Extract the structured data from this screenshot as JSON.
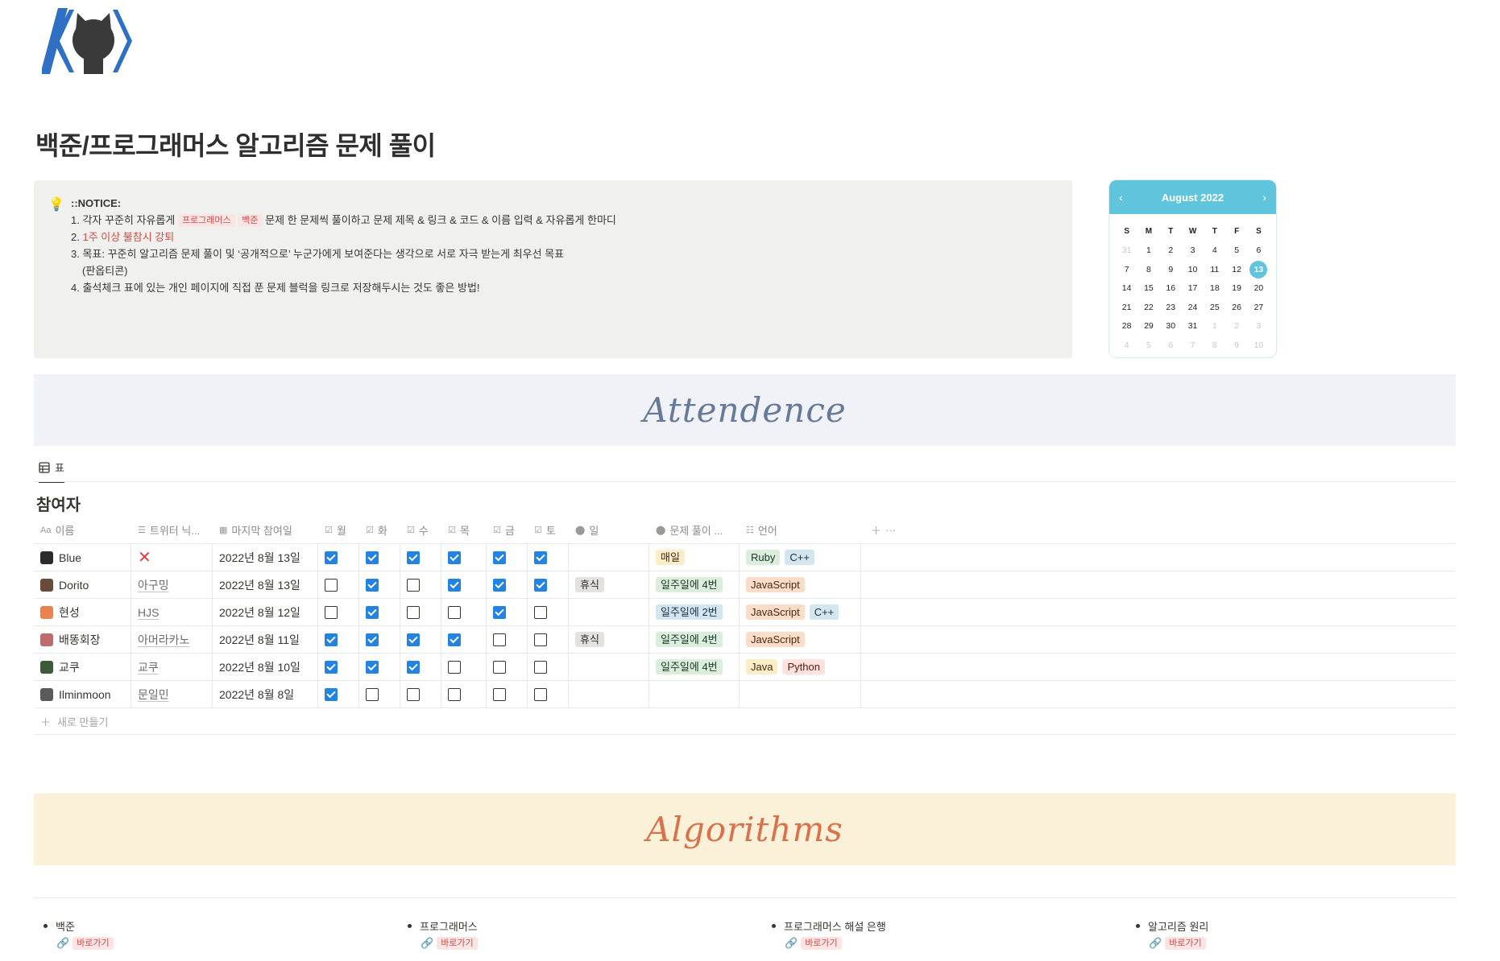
{
  "page": {
    "title": "백준/프로그래머스 알고리즘 문제 풀이"
  },
  "notice": {
    "heading": "::NOTICE:",
    "items": {
      "i1_prefix": "1.  각자 꾸준히 자유롭게 ",
      "i1_tag1": "프로그래머스",
      "i1_tag2": "백준",
      "i1_suffix": " 문제 한 문제씩 풀이하고 문제 제목 & 링크 & 코드 & 이름 입력 & 자유롭게 한마디",
      "i2_prefix": "2. ",
      "i2_red": "1주 이상 불참시 강퇴",
      "i3": "3. 목표: 꾸준히 알고리즘 문제 풀이 및 ‘공개적으로’ 누군가에게 보여준다는 생각으로 서로 자극 받는게 최우선 목표",
      "i3b": "(판옵티콘)",
      "i4": "4. 출석체크 표에 있는 개인 페이지에 직접 푼 문제 블럭을 링크로 저장해두시는 것도 좋은 방법!"
    }
  },
  "calendar": {
    "month": "August 2022",
    "prev": "‹",
    "next": "›",
    "dow": [
      "S",
      "M",
      "T",
      "W",
      "T",
      "F",
      "S"
    ],
    "weeks": [
      [
        "31",
        "1",
        "2",
        "3",
        "4",
        "5",
        "6"
      ],
      [
        "7",
        "8",
        "9",
        "10",
        "11",
        "12",
        "13"
      ],
      [
        "14",
        "15",
        "16",
        "17",
        "18",
        "19",
        "20"
      ],
      [
        "21",
        "22",
        "23",
        "24",
        "25",
        "26",
        "27"
      ],
      [
        "28",
        "29",
        "30",
        "31",
        "1",
        "2",
        "3"
      ],
      [
        "4",
        "5",
        "6",
        "7",
        "8",
        "9",
        "10"
      ]
    ],
    "today": "13",
    "accent": "#5fc4dc"
  },
  "banners": {
    "attendence": "Attendence",
    "algorithms": "Algorithms"
  },
  "database": {
    "view_tab": "표",
    "title": "참여자",
    "columns": {
      "name": "이름",
      "twitter": "트위터 닉...",
      "last": "마지막 참여일",
      "mon": "월",
      "tue": "화",
      "wed": "수",
      "thu": "목",
      "fri": "금",
      "sat": "토",
      "sun": "일",
      "freq": "문제 풀이 ...",
      "lang": "언어"
    },
    "rows": [
      {
        "name": "Blue",
        "twitter": "",
        "twitter_x": true,
        "last": "2022년 8월 13일",
        "days": [
          true,
          true,
          true,
          true,
          true,
          true
        ],
        "sun": "",
        "freq": "매일",
        "freq_color": "yellow",
        "langs": [
          {
            "t": "Ruby",
            "c": "green"
          },
          {
            "t": "C++",
            "c": "blue"
          }
        ]
      },
      {
        "name": "Dorito",
        "twitter": "아구밍",
        "twitter_x": false,
        "last": "2022년 8월 13일",
        "days": [
          false,
          true,
          false,
          true,
          true,
          true
        ],
        "sun": "휴식",
        "freq": "일주일에 4번",
        "freq_color": "green",
        "langs": [
          {
            "t": "JavaScript",
            "c": "orange"
          }
        ]
      },
      {
        "name": "현성",
        "twitter": "HJS",
        "twitter_x": false,
        "last": "2022년 8월 12일",
        "days": [
          false,
          true,
          false,
          false,
          true,
          false
        ],
        "sun": "",
        "freq": "일주일에 2번",
        "freq_color": "blue",
        "langs": [
          {
            "t": "JavaScript",
            "c": "orange"
          },
          {
            "t": "C++",
            "c": "blue"
          }
        ]
      },
      {
        "name": "배똥회장",
        "twitter": "아머라카노",
        "twitter_x": false,
        "last": "2022년 8월 11일",
        "days": [
          true,
          true,
          true,
          true,
          false,
          false
        ],
        "sun": "휴식",
        "freq": "일주일에 4번",
        "freq_color": "green",
        "langs": [
          {
            "t": "JavaScript",
            "c": "orange"
          }
        ]
      },
      {
        "name": "교쿠",
        "twitter": "교쿠",
        "twitter_x": false,
        "last": "2022년 8월 10일",
        "days": [
          true,
          true,
          true,
          false,
          false,
          false
        ],
        "sun": "",
        "freq": "일주일에 4번",
        "freq_color": "green",
        "langs": [
          {
            "t": "Java",
            "c": "yellow"
          },
          {
            "t": "Python",
            "c": "red"
          }
        ]
      },
      {
        "name": "Ilminmoon",
        "twitter": "문일민",
        "twitter_x": false,
        "last": "2022년 8월 8일",
        "days": [
          true,
          false,
          false,
          false,
          false,
          false
        ],
        "sun": "",
        "freq": "",
        "freq_color": "",
        "langs": []
      }
    ],
    "new_row": "새로 만들기"
  },
  "algorithms": [
    {
      "title": "백준",
      "link": "바로가기"
    },
    {
      "title": "프로그래머스",
      "link": "바로가기"
    },
    {
      "title": "프로그래머스 해설 은행",
      "link": "바로가기"
    },
    {
      "title": "알고리즘 원리",
      "link": "바로가기"
    }
  ]
}
